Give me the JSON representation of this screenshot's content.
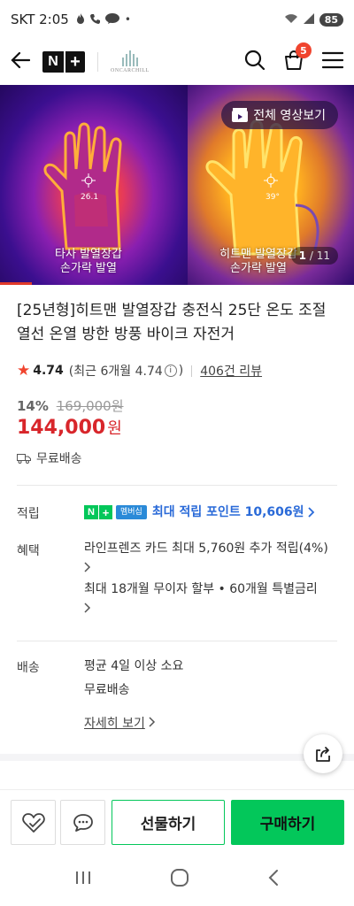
{
  "status_bar": {
    "carrier_time": "SKT 2:05",
    "battery": "85"
  },
  "header": {
    "logo_n": "N",
    "logo_plus": "+",
    "brand_name": "ONCARCHILL",
    "cart_count": "5"
  },
  "gallery": {
    "video_button": "전체 영상보기",
    "caption_left_line1": "타사 발열장갑",
    "caption_left_line2": "손가락 발열",
    "caption_right_line1": "히트맨 발열장갑",
    "caption_right_line2": "손가락 발열",
    "temp_left": "26.1",
    "temp_right": "39°",
    "current": "1",
    "total": "/ 11",
    "progress_fraction": 0.09
  },
  "product": {
    "title": "[25년형]히트맨 발열장갑 충전식 25단 온도 조절 열선 온열 방한 방풍 바이크 자전거",
    "rating": "4.74",
    "recent_rating_prefix": "(최근 6개월 4.74",
    "recent_rating_suffix": ")",
    "reviews": "406건 리뷰",
    "discount_pct": "14%",
    "original_price": "169,000원",
    "price": "144,000",
    "price_unit": "원",
    "shipping_badge": "무료배송"
  },
  "details": {
    "points_label": "적립",
    "points_membership": "멤버십",
    "points_text": "최대 적립 포인트 10,606원",
    "benefit_label": "혜택",
    "benefit_line1": "라인프렌즈 카드 최대 5,760원 추가 적립(4%)",
    "benefit_line2": "최대 18개월 무이자 할부 • 60개월 특별금리",
    "delivery_label": "배송",
    "delivery_line1": "평균 4일 이상 소요",
    "delivery_line2": "무료배송",
    "detail_link": "자세히 보기"
  },
  "bottom_bar": {
    "gift_button": "선물하기",
    "buy_button": "구매하기"
  },
  "colors": {
    "accent_green": "#03c75a",
    "price_red": "#d8262b",
    "badge_red": "#f0442e"
  }
}
